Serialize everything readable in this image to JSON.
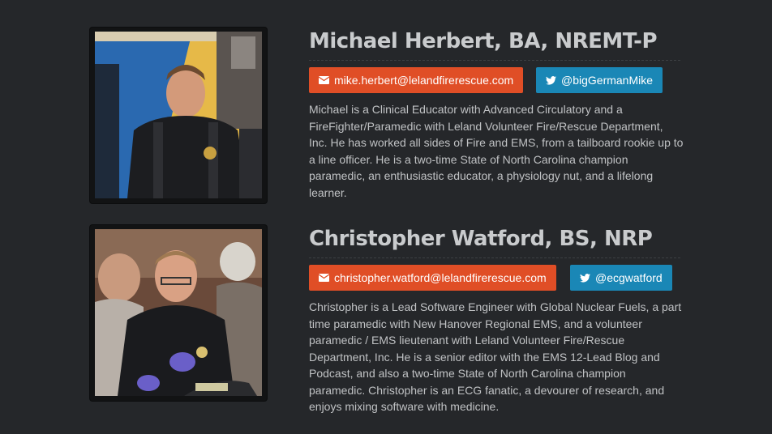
{
  "people": [
    {
      "name": "Michael Herbert, BA, NREMT-P",
      "email": "mike.herbert@lelandfirerescue.com",
      "twitter": "@bigGermanMike",
      "bio": "Michael is a Clinical Educator with Advanced Circulatory and a FireFighter/Paramedic with Leland Volunteer Fire/Rescue Department, Inc. He has worked all sides of Fire and EMS, from a tailboard rookie up to a line officer. He is a two-time State of North Carolina champion paramedic, an enthusiastic educator, a physiology nut, and a lifelong learner."
    },
    {
      "name": "Christopher Watford, BS, NRP",
      "email": "christopher.watford@lelandfirerescue.com",
      "twitter": "@ecgwatford",
      "bio": "Christopher is a Lead Software Engineer with Global Nuclear Fuels, a part time paramedic with New Hanover Regional EMS, and a volunteer paramedic / EMS lieutenant with Leland Volunteer Fire/Rescue Department, Inc. He is a senior editor with the EMS 12-Lead Blog and Podcast, and also a two-time State of North Carolina champion paramedic. Christopher is an ECG fanatic, a devourer of research, and enjoys mixing software with medicine."
    }
  ],
  "colors": {
    "background": "#25272a",
    "email_button": "#e04e26",
    "twitter_button": "#1a87b6",
    "heading": "#c9cbcd",
    "body_text": "#c0c2c4"
  },
  "icons": {
    "email": "envelope-icon",
    "twitter": "twitter-bird-icon"
  }
}
